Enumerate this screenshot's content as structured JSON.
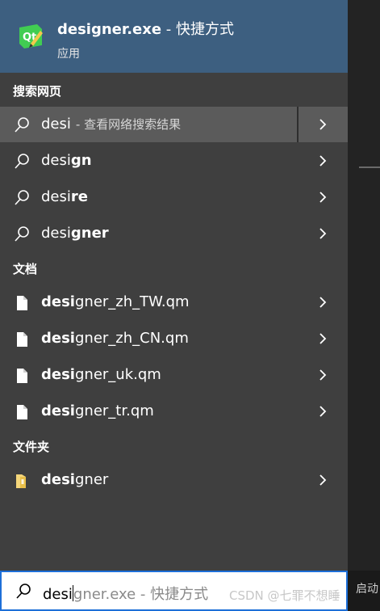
{
  "best_match": {
    "title_bold": "designer.exe",
    "title_rest": " - 快捷方式",
    "subtitle": "应用",
    "icon": "qt-designer-icon"
  },
  "sections": {
    "web": "搜索网页",
    "docs": "文档",
    "folders": "文件夹"
  },
  "web_results": [
    {
      "bold": "",
      "rest": "desi",
      "hint": "- 查看网络搜索结果"
    },
    {
      "bold": "desi",
      "rest": "gn"
    },
    {
      "bold": "desi",
      "rest": "re"
    },
    {
      "bold": "desi",
      "rest": "gner"
    }
  ],
  "doc_results": [
    {
      "bold": "desi",
      "rest": "gner_zh_TW.qm"
    },
    {
      "bold": "desi",
      "rest": "gner_zh_CN.qm"
    },
    {
      "bold": "desi",
      "rest": "gner_uk.qm"
    },
    {
      "bold": "desi",
      "rest": "gner_tr.qm"
    }
  ],
  "folder_results": [
    {
      "bold": "desi",
      "rest": "gner"
    }
  ],
  "search": {
    "typed": "desi",
    "ghost": "gner.exe - 快捷方式"
  },
  "watermark": "CSDN @七罪不想睡",
  "right_partial_text": "启动"
}
